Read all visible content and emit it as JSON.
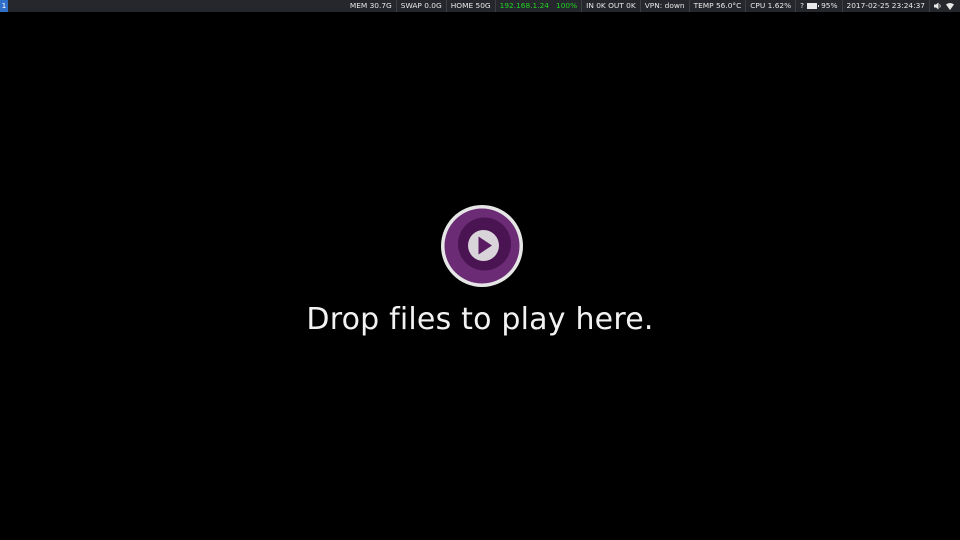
{
  "workspace": "1",
  "status": {
    "mem": "MEM 30.7G",
    "swap": "SWAP 0.0G",
    "home": "HOME 50G",
    "ip": "192.168.1.24",
    "signal": "100%",
    "net": "IN 0K OUT 0K",
    "vpn": "VPN: down",
    "temp": "TEMP 56.0°C",
    "cpu": "CPU 1.62%",
    "battery_unknown": "?",
    "battery_percent": "95%",
    "battery_level": 0.95,
    "datetime": "2017-02-25 23:24:37"
  },
  "player": {
    "message": "Drop files to play here."
  },
  "icons": {
    "logo": "mpv-logo-icon",
    "volume": "speaker-icon",
    "battery": "battery-icon",
    "wifi": "wifi-signal-icon"
  },
  "colors": {
    "bar_bg": "#25272c",
    "workspace_active": "#2f6fc7",
    "ok_green": "#22d322",
    "logo_outer": "#e6e6e6",
    "logo_ring": "#6b2b75",
    "logo_mid": "#4a1352",
    "logo_inner": "#2a0630"
  }
}
